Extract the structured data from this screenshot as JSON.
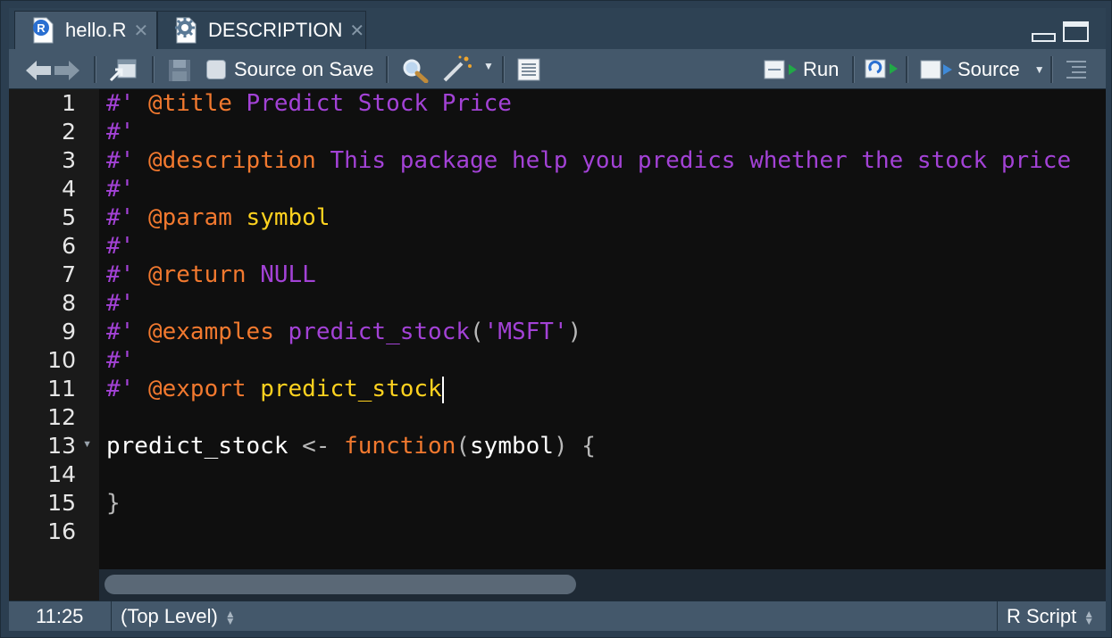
{
  "tabs": [
    {
      "label": "hello.R",
      "icon": "r-file-icon",
      "active": true
    },
    {
      "label": "DESCRIPTION",
      "icon": "gear-file-icon",
      "active": false
    }
  ],
  "toolbar": {
    "source_on_save_label": "Source on Save",
    "run_label": "Run",
    "source_label": "Source"
  },
  "editor": {
    "line_numbers": [
      "1",
      "2",
      "3",
      "4",
      "5",
      "6",
      "7",
      "8",
      "9",
      "10",
      "11",
      "12",
      "13",
      "14",
      "15",
      "16"
    ],
    "lines": [
      [
        {
          "t": "#'",
          "c": "cm"
        },
        {
          "t": " ",
          "c": "cm"
        },
        {
          "t": "@title",
          "c": "tg"
        },
        {
          "t": " Predict Stock Price",
          "c": "cm"
        }
      ],
      [
        {
          "t": "#'",
          "c": "cm"
        }
      ],
      [
        {
          "t": "#'",
          "c": "cm"
        },
        {
          "t": " ",
          "c": "cm"
        },
        {
          "t": "@description",
          "c": "tg"
        },
        {
          "t": " This package help you predics whether the stock price",
          "c": "cm"
        }
      ],
      [
        {
          "t": "#'",
          "c": "cm"
        }
      ],
      [
        {
          "t": "#'",
          "c": "cm"
        },
        {
          "t": " ",
          "c": "cm"
        },
        {
          "t": "@param",
          "c": "tg"
        },
        {
          "t": " ",
          "c": "cm"
        },
        {
          "t": "symbol",
          "c": "prm"
        }
      ],
      [
        {
          "t": "#'",
          "c": "cm"
        }
      ],
      [
        {
          "t": "#'",
          "c": "cm"
        },
        {
          "t": " ",
          "c": "cm"
        },
        {
          "t": "@return",
          "c": "tg"
        },
        {
          "t": " NULL",
          "c": "cm"
        }
      ],
      [
        {
          "t": "#'",
          "c": "cm"
        }
      ],
      [
        {
          "t": "#'",
          "c": "cm"
        },
        {
          "t": " ",
          "c": "cm"
        },
        {
          "t": "@examples",
          "c": "tg"
        },
        {
          "t": " predict_stock",
          "c": "cm"
        },
        {
          "t": "(",
          "c": "op"
        },
        {
          "t": "'MSFT'",
          "c": "str"
        },
        {
          "t": ")",
          "c": "op"
        }
      ],
      [
        {
          "t": "#'",
          "c": "cm"
        }
      ],
      [
        {
          "t": "#'",
          "c": "cm"
        },
        {
          "t": " ",
          "c": "cm"
        },
        {
          "t": "@export",
          "c": "tg"
        },
        {
          "t": " ",
          "c": "cm"
        },
        {
          "t": "predict_stock",
          "c": "prm"
        }
      ],
      [],
      [
        {
          "t": "predict_stock",
          "c": "dflt"
        },
        {
          "t": " <- ",
          "c": "op"
        },
        {
          "t": "function",
          "c": "kw"
        },
        {
          "t": "(",
          "c": "op"
        },
        {
          "t": "symbol",
          "c": "dflt"
        },
        {
          "t": ") {",
          "c": "op"
        }
      ],
      [],
      [
        {
          "t": "}",
          "c": "op"
        }
      ],
      []
    ],
    "fold_line": 13,
    "cursor_line": 11
  },
  "status": {
    "position": "11:25",
    "scope": "(Top Level)",
    "file_type": "R Script"
  }
}
